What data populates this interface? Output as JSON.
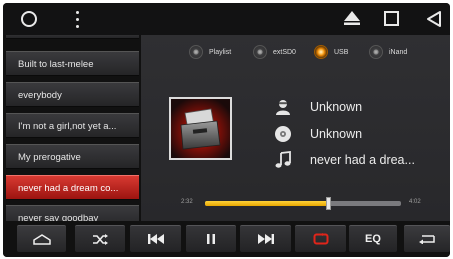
{
  "playlist": {
    "items": [
      {
        "label": "Built to last-melee",
        "active": false
      },
      {
        "label": "everybody",
        "active": false
      },
      {
        "label": "I'm not a girl,not yet a...",
        "active": false
      },
      {
        "label": "My prerogative",
        "active": false
      },
      {
        "label": "never had a dream co...",
        "active": true
      },
      {
        "label": "never say goodbay",
        "active": false
      }
    ]
  },
  "sources": {
    "items": [
      {
        "label": "Playlist",
        "active": false
      },
      {
        "label": "extSD0",
        "active": false
      },
      {
        "label": "USB",
        "active": true
      },
      {
        "label": "iNand",
        "active": false
      }
    ]
  },
  "track": {
    "artist": "Unknown",
    "album": "Unknown",
    "title": "never had a drea..."
  },
  "progress": {
    "elapsed": "2:32",
    "total": "4:02",
    "fraction": 0.63
  },
  "controls": {
    "eq_label": "EQ"
  },
  "colors": {
    "accent_red": "#c8201a",
    "progress_yellow": "#f5c518",
    "source_active_orange": "#ff9a1a"
  },
  "icons": {
    "statusbar": [
      "circle-icon",
      "overflow-menu-icon",
      "home-icon",
      "recent-apps-icon",
      "back-icon"
    ],
    "controls": [
      "home-icon",
      "shuffle-icon",
      "previous-icon",
      "pause-icon",
      "next-icon",
      "repeat-icon",
      "eq",
      "return-icon"
    ]
  }
}
